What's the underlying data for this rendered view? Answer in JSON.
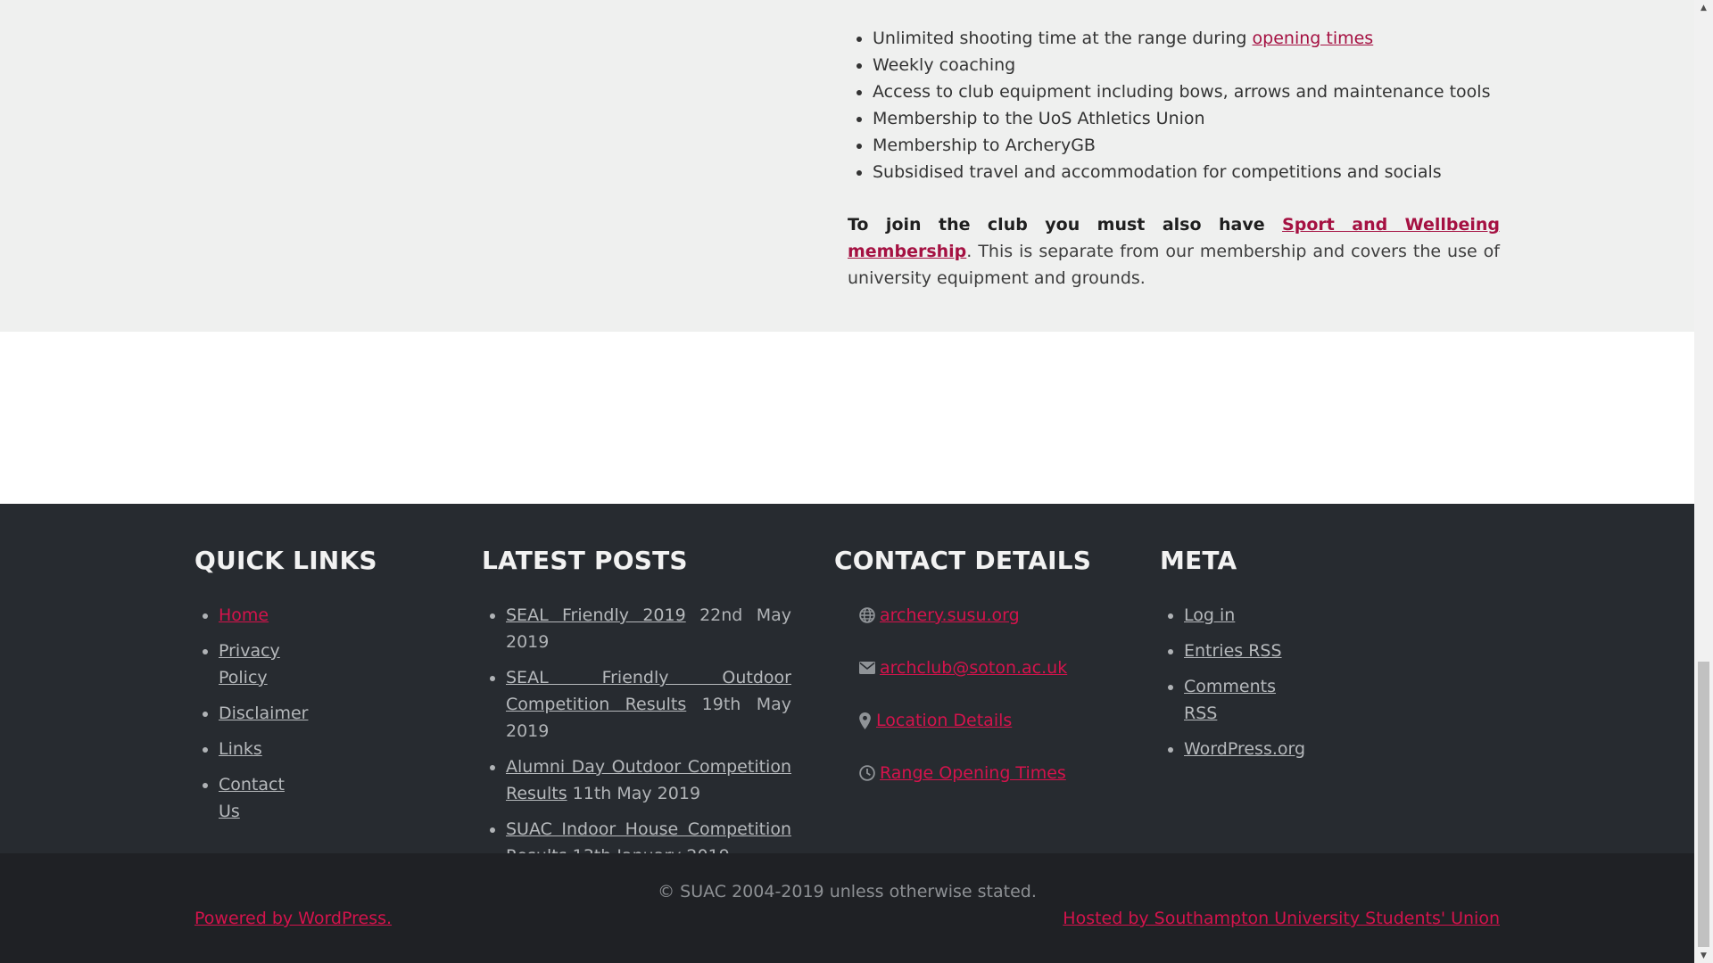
{
  "benefits": {
    "item1_text": "Unlimited shooting time at the range during ",
    "item1_link": "opening times",
    "items": [
      "Weekly coaching",
      "Access to club equipment including bows, arrows and maintenance tools",
      "Membership to the UoS Athletics Union",
      "Membership to ArcheryGB",
      "Subsidised travel and accommodation for competitions and socials"
    ]
  },
  "join": {
    "bold_text": "To join the club you must also have ",
    "link": "Sport and Wellbeing membership",
    "rest": ". This is separate from our membership and covers the use of university equipment and grounds."
  },
  "quick_links": {
    "title": "QUICK LINKS",
    "items": [
      "Home",
      "Privacy Policy",
      "Disclaimer",
      "Links",
      "Contact Us"
    ]
  },
  "latest_posts": {
    "title": "LATEST POSTS",
    "items": [
      {
        "title": "SEAL Friendly 2019",
        "date": "22nd May 2019"
      },
      {
        "title": "SEAL Friendly Outdoor Competition Results",
        "date": "19th May 2019"
      },
      {
        "title": "Alumni Day Outdoor Competition Results",
        "date": "11th May 2019"
      },
      {
        "title": "SUAC Indoor House Competition Results",
        "date": "13th January 2019"
      }
    ]
  },
  "contact": {
    "title": "CONTACT DETAILS",
    "items": [
      {
        "icon": "globe-icon",
        "text": "archery.susu.org"
      },
      {
        "icon": "envelope-icon",
        "text": "archclub@soton.ac.uk"
      },
      {
        "icon": "map-pin-icon",
        "text": "Location Details"
      },
      {
        "icon": "clock-icon",
        "text": "Range Opening Times"
      }
    ]
  },
  "meta": {
    "title": "META",
    "items": [
      "Log in",
      "Entries RSS",
      "Comments RSS",
      "WordPress.org"
    ]
  },
  "site_info": {
    "copyright": "© SUAC 2004-2019 unless otherwise stated.",
    "powered": "Powered by WordPress.",
    "hosted": "Hosted by Southampton University Students' Union"
  },
  "colors": {
    "accent": "#d4134c",
    "content_link": "#a51142",
    "footer_bg": "#272b30",
    "bottom_bg": "#1f2125",
    "content_bg": "#eff0ef"
  }
}
